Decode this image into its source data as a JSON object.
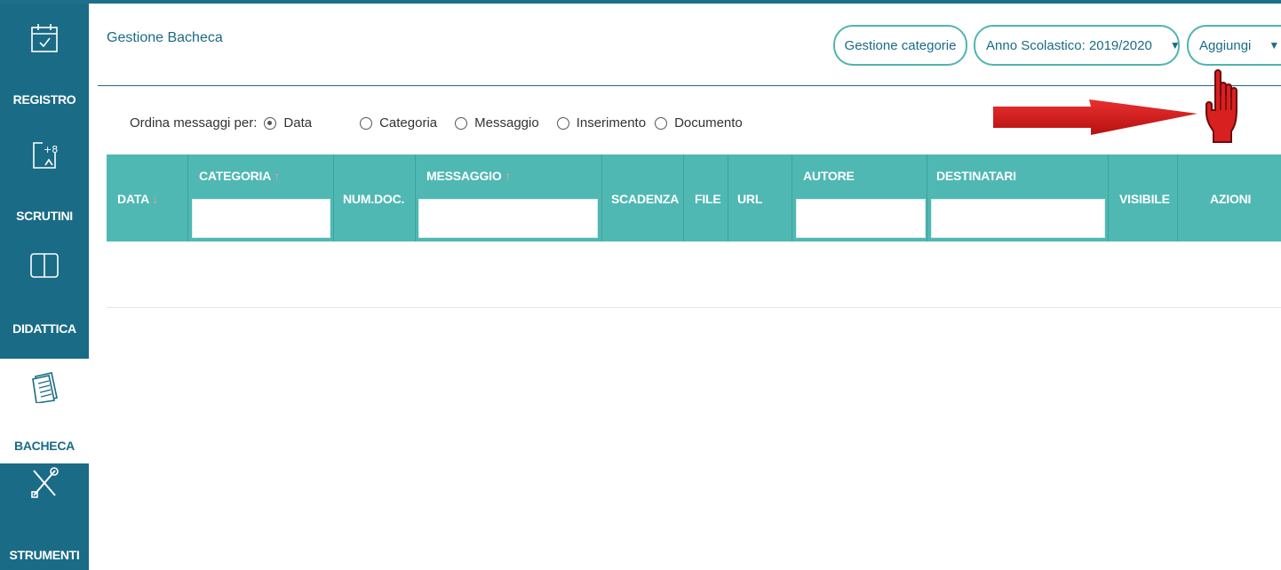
{
  "sidebar": {
    "items": [
      {
        "label": "REGISTRO",
        "icon": "calendar-check-icon"
      },
      {
        "label": "SCRUTINI",
        "icon": "plus-eight-icon"
      },
      {
        "label": "DIDATTICA",
        "icon": "book-icon"
      },
      {
        "label": "BACHECA",
        "icon": "notepad-icon",
        "active": true
      },
      {
        "label": "STRUMENTI",
        "icon": "tools-icon"
      }
    ]
  },
  "header": {
    "title": "Gestione Bacheca",
    "gestione_categorie": "Gestione categorie",
    "anno_scolastico": "Anno Scolastico: 2019/2020",
    "aggiungi": "Aggiungi"
  },
  "sort": {
    "label": "Ordina messaggi per:",
    "options": [
      "Data",
      "Categoria",
      "Messaggio",
      "Inserimento",
      "Documento"
    ],
    "selected": "Data"
  },
  "table": {
    "columns": {
      "data": "DATA",
      "categoria": "CATEGORIA",
      "numdoc": "NUM.DOC.",
      "messaggio": "MESSAGGIO",
      "scadenza": "SCADENZA",
      "file": "FILE",
      "url": "URL",
      "autore": "AUTORE",
      "destinatari": "DESTINATARI",
      "visibile": "VISIBILE",
      "azioni": "AZIONI"
    },
    "sort_down": "↓",
    "sort_up": "↑"
  },
  "colors": {
    "sidebar": "#1a6b86",
    "table_header": "#4fb8b3",
    "accent": "#4fb5b0",
    "arrow": "#e02020"
  }
}
